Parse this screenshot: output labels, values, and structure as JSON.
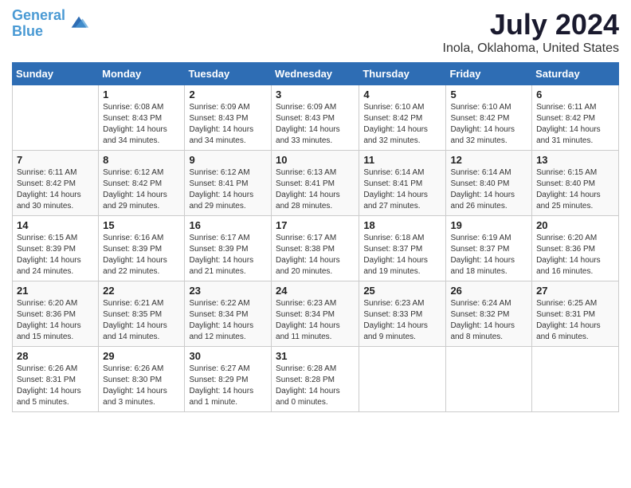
{
  "logo": {
    "line1": "General",
    "line2": "Blue"
  },
  "title": "July 2024",
  "subtitle": "Inola, Oklahoma, United States",
  "header_days": [
    "Sunday",
    "Monday",
    "Tuesday",
    "Wednesday",
    "Thursday",
    "Friday",
    "Saturday"
  ],
  "weeks": [
    [
      {
        "day": "",
        "sunrise": "",
        "sunset": "",
        "daylight": ""
      },
      {
        "day": "1",
        "sunrise": "Sunrise: 6:08 AM",
        "sunset": "Sunset: 8:43 PM",
        "daylight": "Daylight: 14 hours and 34 minutes."
      },
      {
        "day": "2",
        "sunrise": "Sunrise: 6:09 AM",
        "sunset": "Sunset: 8:43 PM",
        "daylight": "Daylight: 14 hours and 34 minutes."
      },
      {
        "day": "3",
        "sunrise": "Sunrise: 6:09 AM",
        "sunset": "Sunset: 8:43 PM",
        "daylight": "Daylight: 14 hours and 33 minutes."
      },
      {
        "day": "4",
        "sunrise": "Sunrise: 6:10 AM",
        "sunset": "Sunset: 8:42 PM",
        "daylight": "Daylight: 14 hours and 32 minutes."
      },
      {
        "day": "5",
        "sunrise": "Sunrise: 6:10 AM",
        "sunset": "Sunset: 8:42 PM",
        "daylight": "Daylight: 14 hours and 32 minutes."
      },
      {
        "day": "6",
        "sunrise": "Sunrise: 6:11 AM",
        "sunset": "Sunset: 8:42 PM",
        "daylight": "Daylight: 14 hours and 31 minutes."
      }
    ],
    [
      {
        "day": "7",
        "sunrise": "Sunrise: 6:11 AM",
        "sunset": "Sunset: 8:42 PM",
        "daylight": "Daylight: 14 hours and 30 minutes."
      },
      {
        "day": "8",
        "sunrise": "Sunrise: 6:12 AM",
        "sunset": "Sunset: 8:42 PM",
        "daylight": "Daylight: 14 hours and 29 minutes."
      },
      {
        "day": "9",
        "sunrise": "Sunrise: 6:12 AM",
        "sunset": "Sunset: 8:41 PM",
        "daylight": "Daylight: 14 hours and 29 minutes."
      },
      {
        "day": "10",
        "sunrise": "Sunrise: 6:13 AM",
        "sunset": "Sunset: 8:41 PM",
        "daylight": "Daylight: 14 hours and 28 minutes."
      },
      {
        "day": "11",
        "sunrise": "Sunrise: 6:14 AM",
        "sunset": "Sunset: 8:41 PM",
        "daylight": "Daylight: 14 hours and 27 minutes."
      },
      {
        "day": "12",
        "sunrise": "Sunrise: 6:14 AM",
        "sunset": "Sunset: 8:40 PM",
        "daylight": "Daylight: 14 hours and 26 minutes."
      },
      {
        "day": "13",
        "sunrise": "Sunrise: 6:15 AM",
        "sunset": "Sunset: 8:40 PM",
        "daylight": "Daylight: 14 hours and 25 minutes."
      }
    ],
    [
      {
        "day": "14",
        "sunrise": "Sunrise: 6:15 AM",
        "sunset": "Sunset: 8:39 PM",
        "daylight": "Daylight: 14 hours and 24 minutes."
      },
      {
        "day": "15",
        "sunrise": "Sunrise: 6:16 AM",
        "sunset": "Sunset: 8:39 PM",
        "daylight": "Daylight: 14 hours and 22 minutes."
      },
      {
        "day": "16",
        "sunrise": "Sunrise: 6:17 AM",
        "sunset": "Sunset: 8:39 PM",
        "daylight": "Daylight: 14 hours and 21 minutes."
      },
      {
        "day": "17",
        "sunrise": "Sunrise: 6:17 AM",
        "sunset": "Sunset: 8:38 PM",
        "daylight": "Daylight: 14 hours and 20 minutes."
      },
      {
        "day": "18",
        "sunrise": "Sunrise: 6:18 AM",
        "sunset": "Sunset: 8:37 PM",
        "daylight": "Daylight: 14 hours and 19 minutes."
      },
      {
        "day": "19",
        "sunrise": "Sunrise: 6:19 AM",
        "sunset": "Sunset: 8:37 PM",
        "daylight": "Daylight: 14 hours and 18 minutes."
      },
      {
        "day": "20",
        "sunrise": "Sunrise: 6:20 AM",
        "sunset": "Sunset: 8:36 PM",
        "daylight": "Daylight: 14 hours and 16 minutes."
      }
    ],
    [
      {
        "day": "21",
        "sunrise": "Sunrise: 6:20 AM",
        "sunset": "Sunset: 8:36 PM",
        "daylight": "Daylight: 14 hours and 15 minutes."
      },
      {
        "day": "22",
        "sunrise": "Sunrise: 6:21 AM",
        "sunset": "Sunset: 8:35 PM",
        "daylight": "Daylight: 14 hours and 14 minutes."
      },
      {
        "day": "23",
        "sunrise": "Sunrise: 6:22 AM",
        "sunset": "Sunset: 8:34 PM",
        "daylight": "Daylight: 14 hours and 12 minutes."
      },
      {
        "day": "24",
        "sunrise": "Sunrise: 6:23 AM",
        "sunset": "Sunset: 8:34 PM",
        "daylight": "Daylight: 14 hours and 11 minutes."
      },
      {
        "day": "25",
        "sunrise": "Sunrise: 6:23 AM",
        "sunset": "Sunset: 8:33 PM",
        "daylight": "Daylight: 14 hours and 9 minutes."
      },
      {
        "day": "26",
        "sunrise": "Sunrise: 6:24 AM",
        "sunset": "Sunset: 8:32 PM",
        "daylight": "Daylight: 14 hours and 8 minutes."
      },
      {
        "day": "27",
        "sunrise": "Sunrise: 6:25 AM",
        "sunset": "Sunset: 8:31 PM",
        "daylight": "Daylight: 14 hours and 6 minutes."
      }
    ],
    [
      {
        "day": "28",
        "sunrise": "Sunrise: 6:26 AM",
        "sunset": "Sunset: 8:31 PM",
        "daylight": "Daylight: 14 hours and 5 minutes."
      },
      {
        "day": "29",
        "sunrise": "Sunrise: 6:26 AM",
        "sunset": "Sunset: 8:30 PM",
        "daylight": "Daylight: 14 hours and 3 minutes."
      },
      {
        "day": "30",
        "sunrise": "Sunrise: 6:27 AM",
        "sunset": "Sunset: 8:29 PM",
        "daylight": "Daylight: 14 hours and 1 minute."
      },
      {
        "day": "31",
        "sunrise": "Sunrise: 6:28 AM",
        "sunset": "Sunset: 8:28 PM",
        "daylight": "Daylight: 14 hours and 0 minutes."
      },
      {
        "day": "",
        "sunrise": "",
        "sunset": "",
        "daylight": ""
      },
      {
        "day": "",
        "sunrise": "",
        "sunset": "",
        "daylight": ""
      },
      {
        "day": "",
        "sunrise": "",
        "sunset": "",
        "daylight": ""
      }
    ]
  ]
}
